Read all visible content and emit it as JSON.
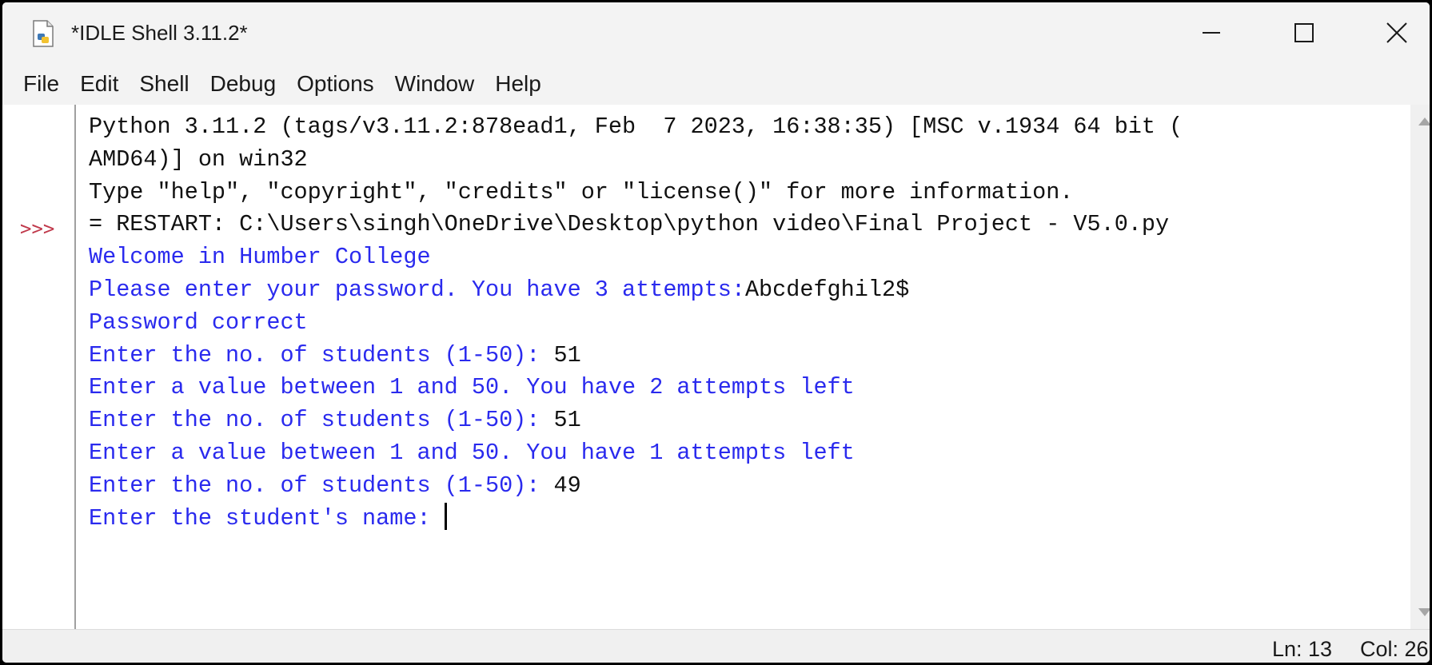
{
  "window": {
    "title": "*IDLE Shell 3.11.2*"
  },
  "menu": {
    "items": [
      "File",
      "Edit",
      "Shell",
      "Debug",
      "Options",
      "Window",
      "Help"
    ]
  },
  "shell": {
    "prompt": ">>>",
    "lines": [
      {
        "text": "Python 3.11.2 (tags/v3.11.2:878ead1, Feb  7 2023, 16:38:35) [MSC v.1934 64 bit (",
        "kind": "stdout"
      },
      {
        "text": "AMD64)] on win32",
        "kind": "stdout"
      },
      {
        "text": "Type \"help\", \"copyright\", \"credits\" or \"license()\" for more information.",
        "kind": "stdout"
      },
      {
        "text": "",
        "kind": "stdout"
      },
      {
        "text": "= RESTART: C:\\Users\\singh\\OneDrive\\Desktop\\python video\\Final Project - V5.0.py",
        "kind": "stdout"
      },
      {
        "text": "Welcome in Humber College",
        "kind": "output"
      },
      {
        "text": "Please enter your password. You have 3 attempts:",
        "input": "Abcdefghil2$",
        "kind": "output"
      },
      {
        "text": "Password correct",
        "kind": "output"
      },
      {
        "text": "Enter the no. of students (1-50): ",
        "input": "51",
        "kind": "output"
      },
      {
        "text": "Enter a value between 1 and 50. You have 2 attempts left",
        "kind": "output"
      },
      {
        "text": "Enter the no. of students (1-50): ",
        "input": "51",
        "kind": "output"
      },
      {
        "text": "Enter a value between 1 and 50. You have 1 attempts left",
        "kind": "output"
      },
      {
        "text": "Enter the no. of students (1-50): ",
        "input": "49",
        "kind": "output"
      },
      {
        "text": "Enter the student's name: ",
        "input": "",
        "kind": "output",
        "cursor": true
      }
    ]
  },
  "status": {
    "ln": "Ln: 13",
    "col": "Col: 26"
  },
  "colors": {
    "output": "#2a2aee",
    "stdout": "#111111",
    "prompt": "#c0394b"
  }
}
